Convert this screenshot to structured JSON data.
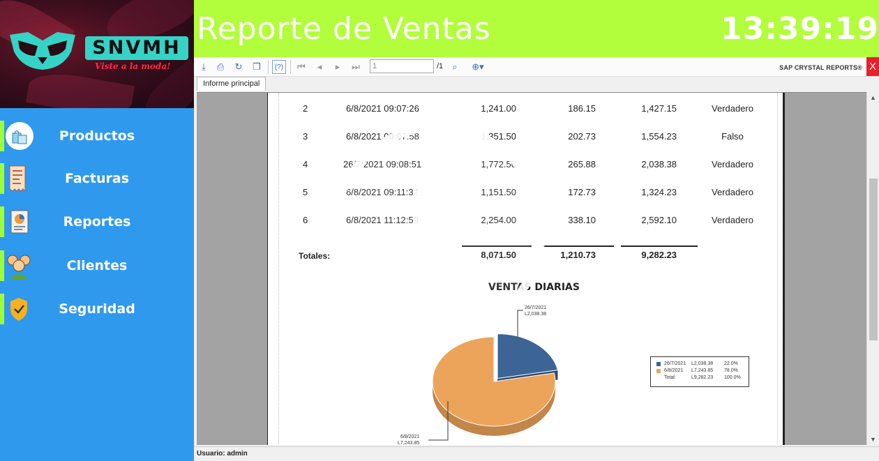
{
  "app": {
    "title": "Reporte de Ventas",
    "clock": "13:39:19",
    "accent": "#b2fd3c",
    "sidebar_bg": "#2f99ee"
  },
  "logo": {
    "brand": "SNVMH",
    "tagline": "Viste a la moda!"
  },
  "sidebar": {
    "items": [
      {
        "label": "Productos",
        "icon": "shopping-bags-icon"
      },
      {
        "label": "Facturas",
        "icon": "invoice-icon"
      },
      {
        "label": "Reportes",
        "icon": "report-icon"
      },
      {
        "label": "Clientes",
        "icon": "users-icon"
      },
      {
        "label": "Seguridad",
        "icon": "shield-check-icon"
      }
    ]
  },
  "viewer": {
    "page_field": "1",
    "page_total": "/1",
    "brand": "SAP CRYSTAL REPORTS®",
    "close": "X",
    "tab": "Informe principal"
  },
  "report": {
    "rows": [
      {
        "num": "2",
        "date": "6/8/2021  09:07:26",
        "subtotal": "1,241.00",
        "iva": "186.15",
        "total": "1,427.15",
        "paid": "Verdadero"
      },
      {
        "num": "3",
        "date": "6/8/2021  09:07:58",
        "subtotal": "1,351.50",
        "iva": "202.73",
        "total": "1,554.23",
        "paid": "Falso"
      },
      {
        "num": "4",
        "date": "26/7/2021  09:08:51",
        "subtotal": "1,772.50",
        "iva": "265.88",
        "total": "2,038.38",
        "paid": "Verdadero"
      },
      {
        "num": "5",
        "date": "6/8/2021  09:11:32",
        "subtotal": "1,151.50",
        "iva": "172.73",
        "total": "1,324.23",
        "paid": "Verdadero"
      },
      {
        "num": "6",
        "date": "6/8/2021  11:12:59",
        "subtotal": "2,254.00",
        "iva": "338.10",
        "total": "2,592.10",
        "paid": "Verdadero"
      }
    ],
    "totals_label": "Totales:",
    "totals": {
      "subtotal": "8,071.50",
      "iva": "1,210.73",
      "total": "9,282.23"
    }
  },
  "chart_data": {
    "type": "pie",
    "title": "VENTAS DIARIAS",
    "categories": [
      "26/7/2021",
      "6/8/2021"
    ],
    "values": [
      2038.38,
      7243.85
    ],
    "percents": [
      22.0,
      78.0
    ],
    "colors": [
      "#3c6494",
      "#eca45a"
    ],
    "slice_labels": [
      {
        "date": "26/7/2021",
        "value": "L2,038.38"
      },
      {
        "date": "6/8/2021",
        "value": "L7,243.85"
      }
    ],
    "legend": {
      "placement": "right",
      "rows": [
        {
          "name": "26/7/2021",
          "value": "L2,038.38",
          "pct": "22.0%"
        },
        {
          "name": "6/8/2021",
          "value": "L7,243.85",
          "pct": "78.0%"
        },
        {
          "name": "Total:",
          "value": "L9,282.23",
          "pct": "100.0%"
        }
      ]
    }
  },
  "status": {
    "user_text": "Usuario: admin"
  }
}
